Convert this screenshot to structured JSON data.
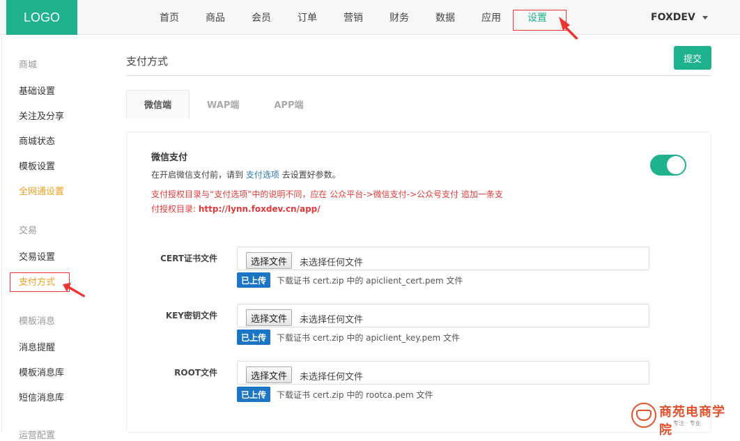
{
  "header": {
    "logo": "LOGO",
    "nav": [
      {
        "label": "首页"
      },
      {
        "label": "商品"
      },
      {
        "label": "会员"
      },
      {
        "label": "订单"
      },
      {
        "label": "营销"
      },
      {
        "label": "财务"
      },
      {
        "label": "数据"
      },
      {
        "label": "应用"
      },
      {
        "label": "设置",
        "active": true
      }
    ],
    "user": "FOXDEV"
  },
  "sidebar": {
    "groups": [
      {
        "title": "商城",
        "items": [
          "基础设置",
          "关注及分享",
          "商城状态",
          "模板设置",
          "全网通设置"
        ]
      },
      {
        "title": "交易",
        "items": [
          "交易设置",
          "支付方式"
        ]
      },
      {
        "title": "模板消息",
        "items": [
          "消息提醒",
          "模板消息库",
          "短信消息库"
        ]
      }
    ],
    "cut_off_group": "运营配置"
  },
  "main": {
    "title": "支付方式",
    "submit_label": "提交",
    "tabs": [
      {
        "label": "微信端",
        "active": true
      },
      {
        "label": "WAP端"
      },
      {
        "label": "APP端"
      }
    ],
    "wechat_pay": {
      "title": "微信支付",
      "desc_before": "在开启微信支付前，请到 ",
      "desc_link": "支付选项",
      "desc_after": " 去设置好参数。",
      "warning_line1": "支付授权目录与“支付选项”中的说明不同，应在 公众平台->微信支付->公众号支付 追加一条支",
      "warning_line2_prefix": "付授权目录: ",
      "warning_url": "http://lynn.foxdev.cn/app/",
      "enabled": true
    },
    "files": [
      {
        "label": "CERT证书文件",
        "button": "选择文件",
        "status": "未选择任何文件",
        "badge": "已上传",
        "help": "下载证书 cert.zip 中的 apiclient_cert.pem 文件"
      },
      {
        "label": "KEY密钥文件",
        "button": "选择文件",
        "status": "未选择任何文件",
        "badge": "已上传",
        "help": "下载证书 cert.zip 中的 apiclient_key.pem 文件"
      },
      {
        "label": "ROOT文件",
        "button": "选择文件",
        "status": "未选择任何文件",
        "badge": "已上传",
        "help": "下载证书 cert.zip 中的 rootca.pem 文件"
      }
    ]
  },
  "watermark": {
    "name": "商苑电商学院",
    "slogan": "专注 · 专业"
  },
  "colors": {
    "accent": "#1fb28f",
    "orange": "#f0a020",
    "warning": "#e23a3a",
    "annotation": "#e33333",
    "badge_blue": "#1b74c4"
  }
}
